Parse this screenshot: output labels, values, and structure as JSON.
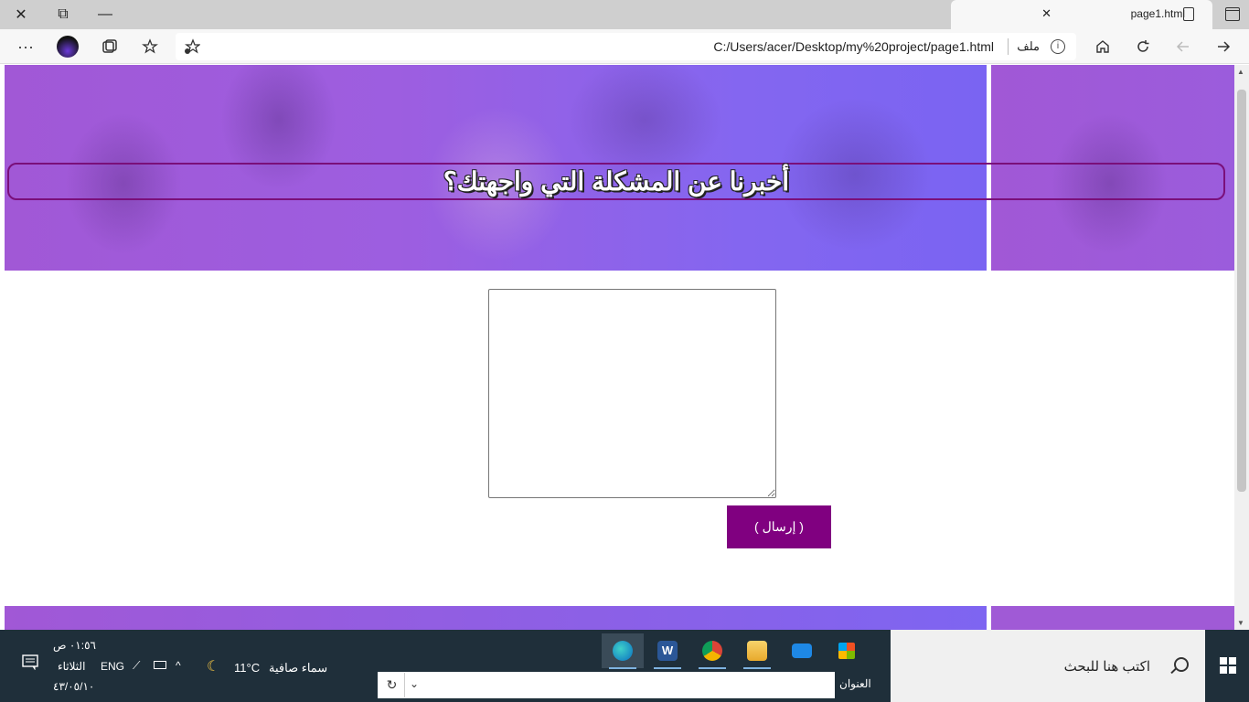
{
  "browser": {
    "tab_title": "page1.html",
    "new_tab_symbol": "+",
    "minimize_symbol": "—",
    "restore_symbol": "⧉",
    "close_symbol": "✕",
    "url": "C:/Users/acer/Desktop/my%20project/page1.html",
    "file_label": "ملف",
    "info_symbol": "i",
    "menu_symbol": "···"
  },
  "page": {
    "heading": "أخبرنا عن المشكلة التي واجهتك؟",
    "textarea_value": "",
    "send_label": "( إرسال )",
    "banner_color": "#9b5ee0",
    "button_color": "#800080"
  },
  "taskbar": {
    "search_placeholder": "اكتب هنا للبحث",
    "address_label": "العنوان",
    "refresh_symbol": "↻",
    "weather_temp": "11°C",
    "weather_text": "سماء صافية",
    "language": "ENG",
    "time": "٠١:٥٦ ص",
    "day": "الثلاثاء",
    "date": "٤٣/٠٥/١٠",
    "apps": [
      "edge",
      "word",
      "chrome",
      "file-explorer",
      "mail",
      "store"
    ]
  }
}
